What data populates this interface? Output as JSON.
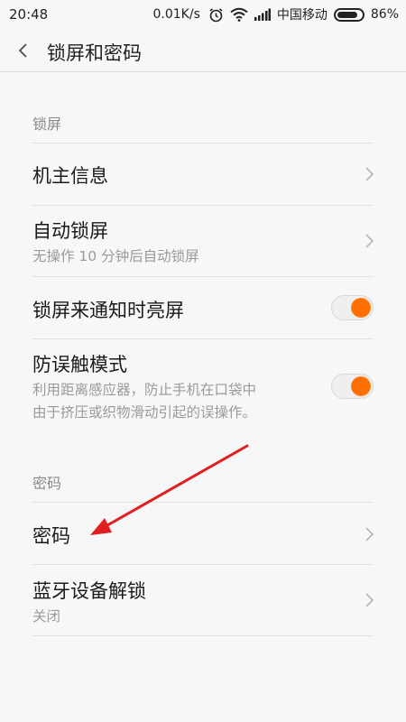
{
  "status_bar": {
    "time": "20:48",
    "speed": "0.01K/s",
    "carrier": "中国移动",
    "battery": "86%",
    "battery_level": 0.86,
    "icons": [
      "alarm-icon",
      "wifi-icon",
      "signal-icon",
      "battery-icon"
    ]
  },
  "header": {
    "title": "锁屏和密码"
  },
  "sections": {
    "lock": "锁屏",
    "password": "密码"
  },
  "items": {
    "owner_info": {
      "title": "机主信息"
    },
    "auto_lock": {
      "title": "自动锁屏",
      "subtitle": "无操作 10 分钟后自动锁屏"
    },
    "notify_wake": {
      "title": "锁屏来通知时亮屏",
      "enabled": true
    },
    "pocket_mode": {
      "title": "防误触模式",
      "subtitle_line1": "利用距离感应器，防止手机在口袋中",
      "subtitle_line2": "由于挤压或织物滑动引起的误操作。",
      "enabled": true
    },
    "password": {
      "title": "密码"
    },
    "bluetooth_unlock": {
      "title": "蓝牙设备解锁",
      "subtitle": "关闭"
    }
  },
  "colors": {
    "accent": "#ff6f00",
    "annotation_arrow": "#e02020"
  }
}
